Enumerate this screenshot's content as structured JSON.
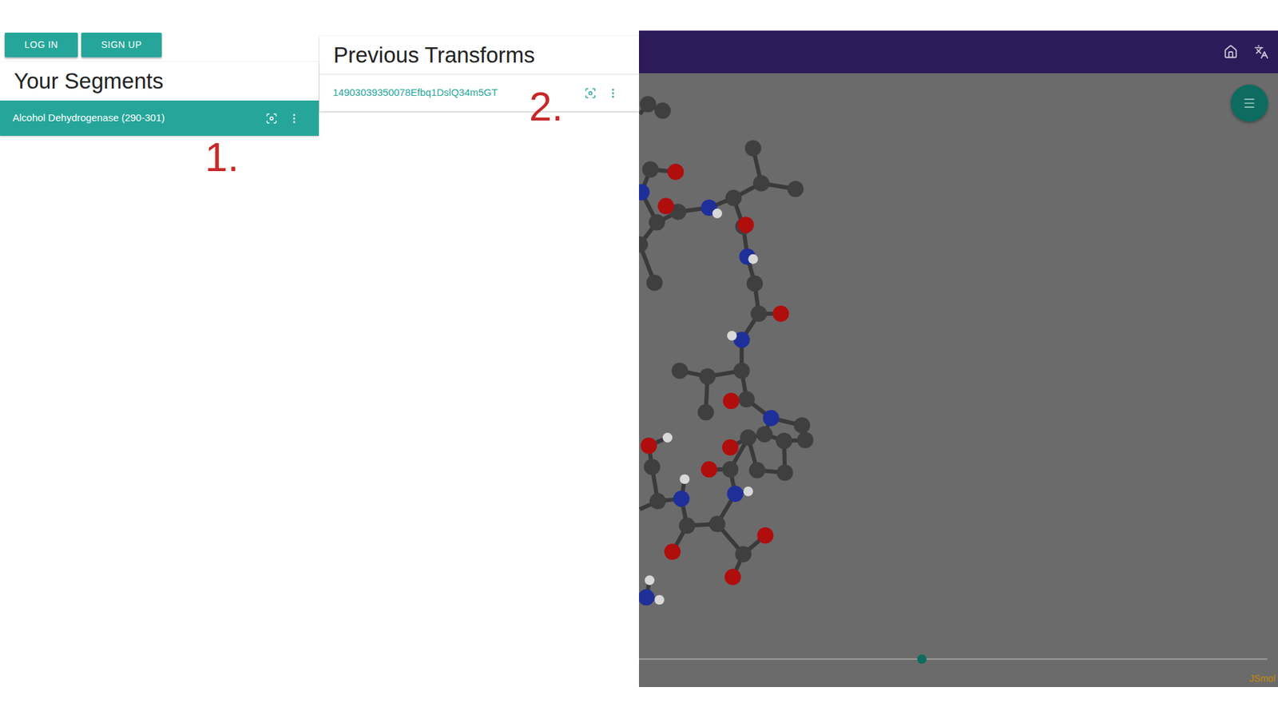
{
  "auth_buttons": [
    "LOG IN",
    "SIGN UP"
  ],
  "segments": {
    "title": "Your Segments",
    "items": [
      {
        "label": "Alcohol Dehydrogenase (290-301)",
        "selected": true
      }
    ],
    "annotation": "1."
  },
  "transforms": {
    "title": "Previous Transforms",
    "items": [
      {
        "label": "14903039350078Efbq1DslQ34m5GT",
        "selected": false
      }
    ],
    "annotation": "2."
  },
  "viewer": {
    "slider": {
      "level": 0.45
    },
    "watermark": "JSmol"
  }
}
